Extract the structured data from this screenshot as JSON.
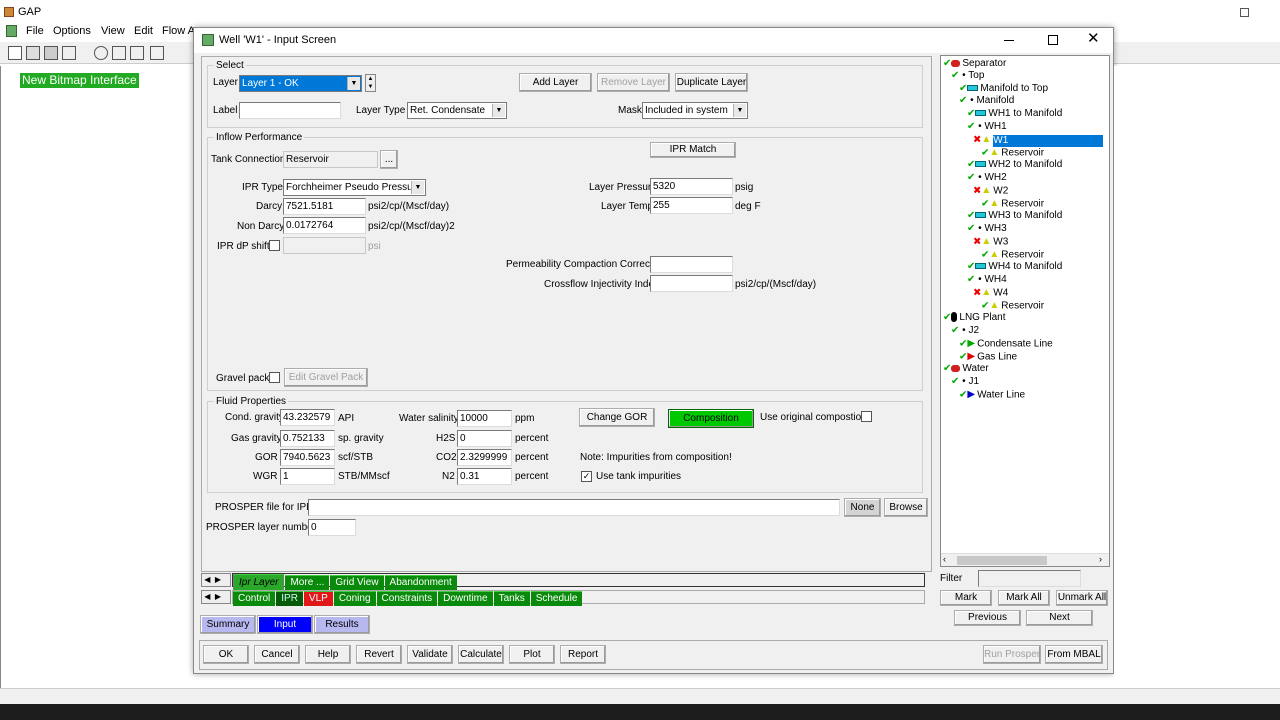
{
  "app": {
    "title": "GAP",
    "menu": [
      "File",
      "Options",
      "View",
      "Edit",
      "Flow A"
    ],
    "bitmap_label": "New Bitmap Interface"
  },
  "dialog": {
    "title": "Well 'W1' - Input Screen"
  },
  "select": {
    "group_label": "Select",
    "layer_label": "Layer",
    "layer_value": "Layer 1 - OK",
    "label_label": "Label",
    "label_value": "",
    "layer_type_label": "Layer Type",
    "layer_type_value": "Ret. Condensate",
    "mask_label": "Mask",
    "mask_value": "Included in system",
    "add_layer": "Add Layer",
    "remove_layer": "Remove Layer",
    "duplicate_layer": "Duplicate Layer"
  },
  "inflow": {
    "group_label": "Inflow Performance",
    "tank_connection_label": "Tank Connection",
    "tank_connection_value": "Reservoir",
    "tank_browse": "...",
    "ipr_match": "IPR Match",
    "ipr_type_label": "IPR Type",
    "ipr_type_value": "Forchheimer Pseudo Pressure",
    "darcy_label": "Darcy",
    "darcy_value": "7521.5181",
    "darcy_unit": "psi2/cp/(Mscf/day)",
    "non_darcy_label": "Non Darcy",
    "non_darcy_value": "0.0172764",
    "non_darcy_unit": "psi2/cp/(Mscf/day)2",
    "dp_shift_label": "IPR dP shift",
    "dp_shift_unit": "psi",
    "layer_pressure_label": "Layer Pressure",
    "layer_pressure_value": "5320",
    "layer_pressure_unit": "psig",
    "layer_temp_label": "Layer Temp",
    "layer_temp_value": "255",
    "layer_temp_unit": "deg F",
    "perm_label": "Permeability Compaction Correction",
    "crossflow_label": "Crossflow Injectivity Index",
    "crossflow_unit": "psi2/cp/(Mscf/day)",
    "gravel_label": "Gravel pack",
    "edit_gravel": "Edit Gravel Pack"
  },
  "fluid": {
    "group_label": "Fluid Properties",
    "cond_gravity_label": "Cond. gravity",
    "cond_gravity_value": "43.232579",
    "cond_gravity_unit": "API",
    "gas_gravity_label": "Gas gravity",
    "gas_gravity_value": "0.752133",
    "gas_gravity_unit": "sp. gravity",
    "gor_label": "GOR",
    "gor_value": "7940.5623",
    "gor_unit": "scf/STB",
    "wgr_label": "WGR",
    "wgr_value": "1",
    "wgr_unit": "STB/MMscf",
    "water_salinity_label": "Water salinity",
    "water_salinity_value": "10000",
    "water_salinity_unit": "ppm",
    "h2s_label": "H2S",
    "h2s_value": "0",
    "h2s_unit": "percent",
    "co2_label": "CO2",
    "co2_value": "2.3299999",
    "co2_unit": "percent",
    "n2_label": "N2",
    "n2_value": "0.31",
    "n2_unit": "percent",
    "change_gor": "Change GOR",
    "composition": "Composition",
    "use_original_label": "Use original compostion",
    "note": "Note: Impurities from composition!",
    "use_tank_label": "Use tank impurities"
  },
  "prosper": {
    "file_label": "PROSPER file for IPR",
    "file_value": "",
    "none_btn": "None",
    "browse_btn": "Browse",
    "layer_number_label": "PROSPER layer number",
    "layer_number_value": "0"
  },
  "tabs_row1": [
    "Ipr Layer",
    "More ...",
    "Grid View",
    "Abandonment"
  ],
  "tabs_row2": [
    "Control",
    "IPR",
    "VLP",
    "Coning",
    "Constraints",
    "Downtime",
    "Tanks",
    "Schedule"
  ],
  "views": [
    "Summary",
    "Input",
    "Results"
  ],
  "actions": [
    "OK",
    "Cancel",
    "Help",
    "Revert",
    "Validate",
    "Calculate",
    "Plot",
    "Report"
  ],
  "run_prosper": "Run Prosper",
  "from_mbal": "From MBAL",
  "tree": [
    {
      "label": "Separator"
    },
    {
      "label": "Top"
    },
    {
      "label": "Manifold to Top"
    },
    {
      "label": "Manifold"
    },
    {
      "label": "WH1 to Manifold"
    },
    {
      "label": "WH1"
    },
    {
      "label": "W1"
    },
    {
      "label": "Reservoir"
    },
    {
      "label": "WH2 to Manifold"
    },
    {
      "label": "WH2"
    },
    {
      "label": "W2"
    },
    {
      "label": "Reservoir"
    },
    {
      "label": "WH3 to Manifold"
    },
    {
      "label": "WH3"
    },
    {
      "label": "W3"
    },
    {
      "label": "Reservoir"
    },
    {
      "label": "WH4 to Manifold"
    },
    {
      "label": "WH4"
    },
    {
      "label": "W4"
    },
    {
      "label": "Reservoir"
    },
    {
      "label": "LNG Plant"
    },
    {
      "label": "J2"
    },
    {
      "label": "Condensate Line"
    },
    {
      "label": "Gas Line"
    },
    {
      "label": "Water"
    },
    {
      "label": "J1"
    },
    {
      "label": "Water Line"
    }
  ],
  "filter_label": "Filter",
  "mark_buttons": [
    "Mark",
    "Mark All",
    "Unmark All"
  ],
  "nav_buttons": [
    "Previous",
    "Next"
  ],
  "colors": {
    "accent_green": "#0a8a0a",
    "selection_blue": "#0078d7",
    "input_view": "#0000ff",
    "composition_green": "#00c800"
  }
}
